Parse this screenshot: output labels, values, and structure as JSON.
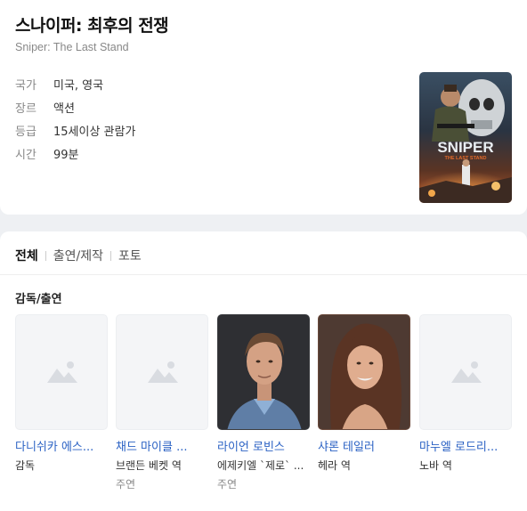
{
  "movie": {
    "title": "스나이퍼: 최후의 전쟁",
    "original_title": "Sniper: The Last Stand",
    "info": [
      {
        "key": "국가",
        "value": "미국, 영국"
      },
      {
        "key": "장르",
        "value": "액션"
      },
      {
        "key": "등급",
        "value": "15세이상 관람가"
      },
      {
        "key": "시간",
        "value": "99분"
      }
    ],
    "poster": {
      "line1": "SNIPER",
      "line2": "THE LAST STAND"
    }
  },
  "tabs": [
    {
      "label": "전체",
      "active": true
    },
    {
      "label": "출연/제작",
      "active": false
    },
    {
      "label": "포토",
      "active": false
    }
  ],
  "section_title": "감독/출연",
  "people": [
    {
      "name": "다니쉬카 에스...",
      "role": "감독",
      "type": "",
      "photo": "placeholder"
    },
    {
      "name": "채드 마이클 ...",
      "role": "브랜든 베켓 역",
      "type": "주연",
      "photo": "placeholder"
    },
    {
      "name": "라이언 로빈스",
      "role": "에제키엘 `제로` ...",
      "type": "주연",
      "photo": "portrait-male"
    },
    {
      "name": "샤론 테일러",
      "role": "헤라 역",
      "type": "",
      "photo": "portrait-female"
    },
    {
      "name": "마누엘 로드리...",
      "role": "노바 역",
      "type": "",
      "photo": "placeholder"
    }
  ]
}
